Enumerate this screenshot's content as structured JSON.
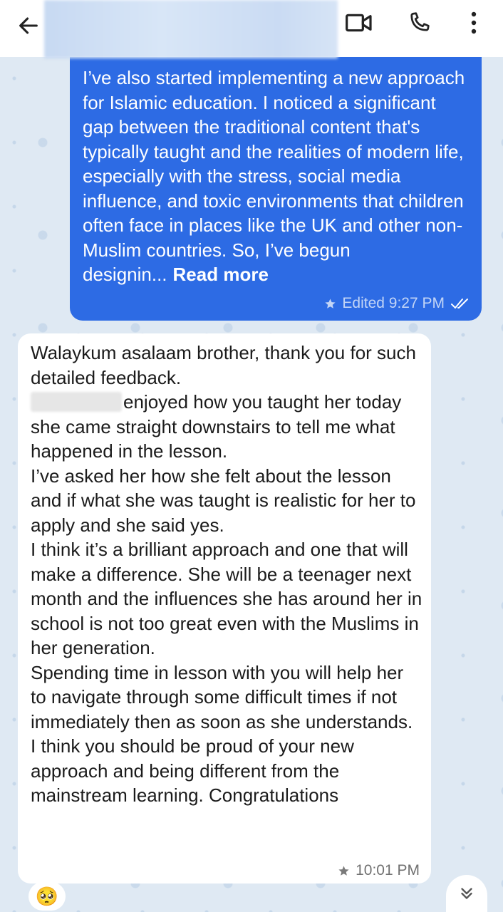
{
  "header": {
    "back_icon": "arrow-left-icon",
    "video_icon": "video-camera-icon",
    "call_icon": "phone-icon",
    "menu_icon": "more-vertical-icon"
  },
  "outgoing_message": {
    "text": "I’ve also started implementing a new approach for Islamic education. I noticed a significant gap between the traditional content that's typically taught and the realities of modern life, especially with the stress, social media influence, and toxic environments that children often face in places like the UK and other non-Muslim countries. So, I’ve begun designin...",
    "read_more": "Read more",
    "meta": "Edited 9:27 PM",
    "star_icon": "star-icon",
    "status_icon": "double-check-icon",
    "background_color": "#2d6be4"
  },
  "incoming_message": {
    "paragraphs": [
      "Walaykum asalaam brother, thank you for such detailed feedback.",
      "enjoyed how you taught her today she came straight downstairs to tell me what happened in the lesson.",
      "I’ve asked her how she felt about the lesson and if what she was taught is realistic for her to apply and she said yes.",
      "I think it’s a brilliant approach and one that will make a difference. She will be a teenager next month and the influences she has around her in school is not too great even with the Muslims in her generation.",
      "Spending time in lesson with you will help her to navigate through some difficult times if not immediately then as soon as she understands.",
      "I think you should be proud of your new approach and being different from the mainstream learning. Congratulations"
    ],
    "time": "10:01 PM",
    "star_icon": "star-icon"
  },
  "reaction": {
    "emoji": "🥺"
  },
  "scroll_down_icon": "double-chevron-down-icon",
  "colors": {
    "chat_background": "#dfe9f3",
    "outgoing_bubble": "#2d6be4",
    "incoming_bubble": "#ffffff"
  }
}
